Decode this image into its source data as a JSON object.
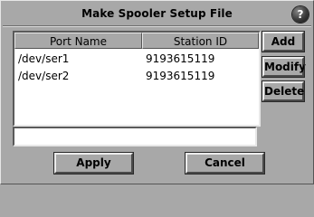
{
  "window": {
    "title": "Make Spooler Setup File",
    "help_glyph": "?"
  },
  "table": {
    "columns": [
      "Port Name",
      "Station ID"
    ],
    "rows": [
      {
        "port": "/dev/ser1",
        "station": "9193615119"
      },
      {
        "port": "/dev/ser2",
        "station": "9193615119"
      }
    ]
  },
  "side_buttons": {
    "add": "Add",
    "modify": "Modify",
    "delete": "Delete"
  },
  "entry": {
    "value": ""
  },
  "bottom_buttons": {
    "apply": "Apply",
    "cancel": "Cancel"
  },
  "colors": {
    "background": "#a8a8a8",
    "field": "#ffffff"
  },
  "icons": {
    "help": "help-icon"
  }
}
